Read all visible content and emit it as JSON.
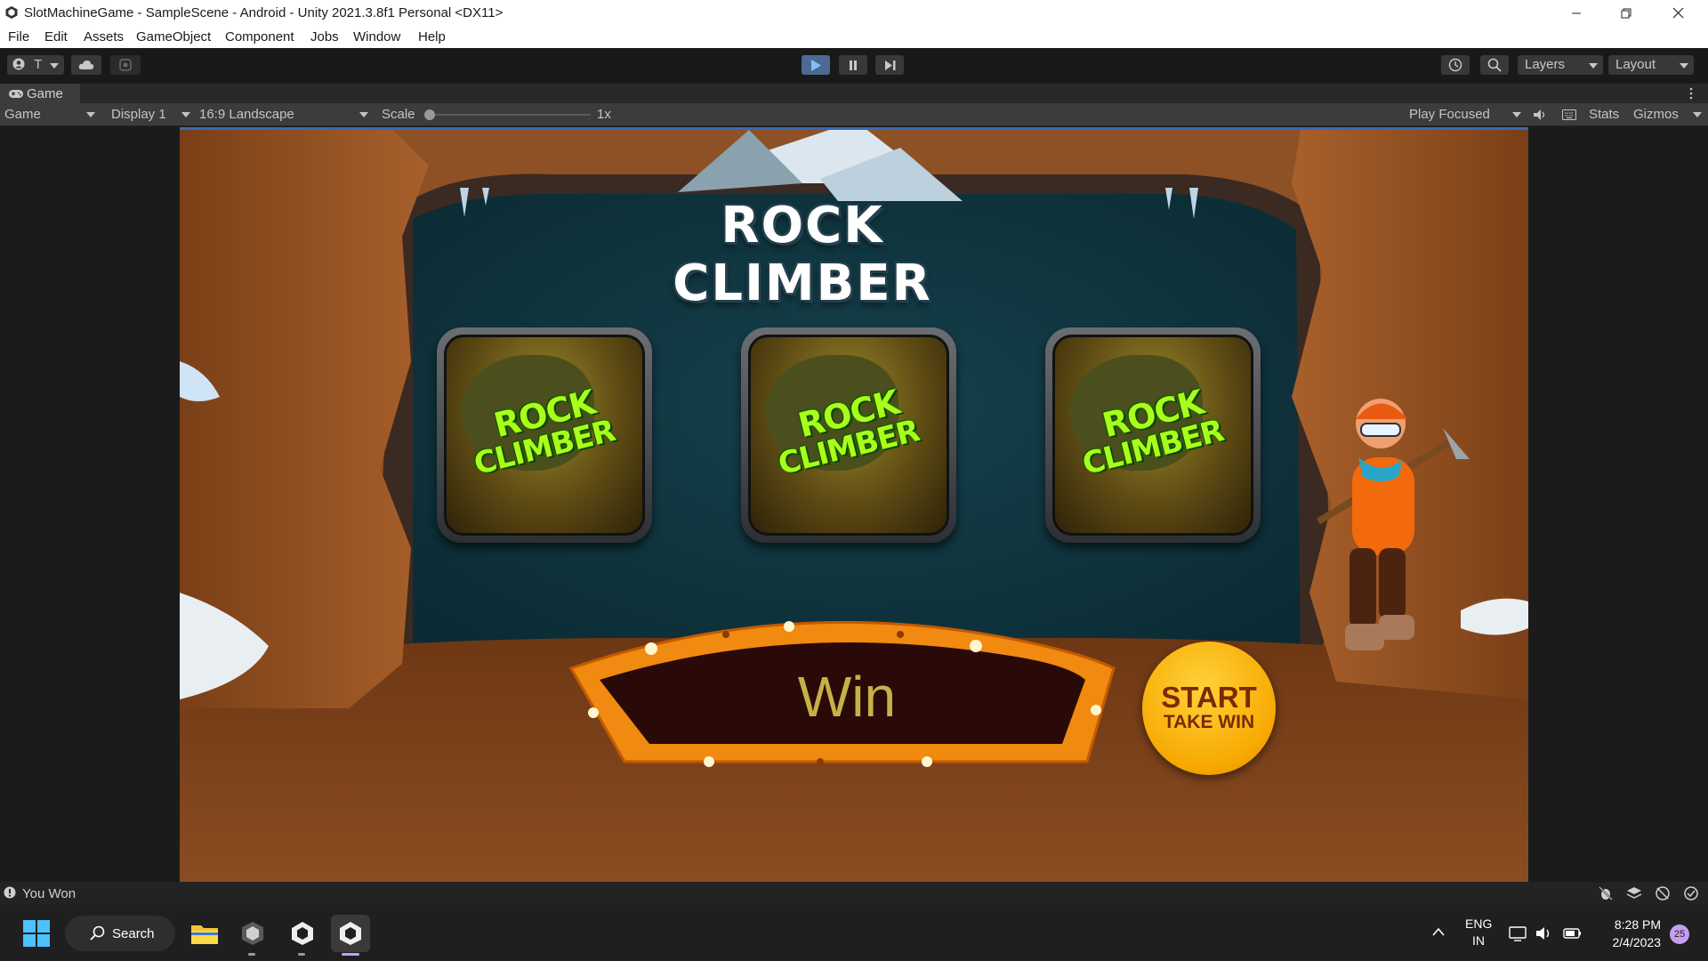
{
  "window": {
    "title": "SlotMachineGame - SampleScene - Android - Unity 2021.3.8f1 Personal <DX11>"
  },
  "menu": [
    "File",
    "Edit",
    "Assets",
    "GameObject",
    "Component",
    "Jobs",
    "Window",
    "Help"
  ],
  "toolbar": {
    "account_label": "T",
    "layers_label": "Layers",
    "layout_label": "Layout"
  },
  "game_tab": {
    "tab_label": "Game",
    "view_select": "Game",
    "display_select": "Display 1",
    "aspect_select": "16:9 Landscape",
    "scale_label": "Scale",
    "scale_value": "1x",
    "play_focused": "Play Focused",
    "stats_label": "Stats",
    "gizmos_label": "Gizmos"
  },
  "game": {
    "title": "ROCK CLIMBER",
    "slots": [
      {
        "line1": "ROCK",
        "line2": "CLIMBER"
      },
      {
        "line1": "ROCK",
        "line2": "CLIMBER"
      },
      {
        "line1": "ROCK",
        "line2": "CLIMBER"
      }
    ],
    "win_text": "Win",
    "start_line1": "START",
    "start_line2": "TAKE WIN"
  },
  "status": {
    "message": "You Won"
  },
  "taskbar": {
    "search_label": "Search",
    "lang_line1": "ENG",
    "lang_line2": "IN",
    "time": "8:28 PM",
    "date": "2/4/2023",
    "notification_count": "25"
  },
  "colors": {
    "accent_blue": "#3a69b5",
    "win_text": "#c8b047",
    "start_button": "#f7b800",
    "cave_brown": "#8a4d22"
  }
}
